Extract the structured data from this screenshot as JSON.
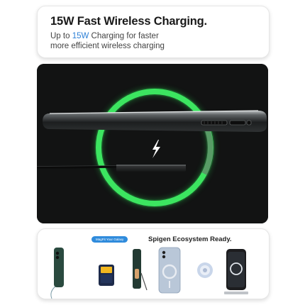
{
  "header": {
    "title": "15W Fast Wireless Charging.",
    "subtitle_line1_pre": "Up to ",
    "subtitle_highlight": "15W",
    "subtitle_line1_post": " Charging for faster",
    "subtitle_line2": "more efficient wireless charging"
  },
  "ecosystem": {
    "badge": "MagFit Your Galaxy",
    "title": "Spigen Ecosystem Ready.",
    "products": [
      {
        "icon": "phone-case-lanyard-icon"
      },
      {
        "icon": "wallet-card-holder-icon"
      },
      {
        "icon": "kickstand-case-icon"
      },
      {
        "icon": "magsafe-phone-case-icon"
      },
      {
        "icon": "magnetic-ring-mount-icon"
      },
      {
        "icon": "wireless-charger-phone-icon"
      }
    ]
  },
  "colors": {
    "accent": "#2b7fd6",
    "glow_ring": "#36e05a",
    "hero_background": "#121313"
  }
}
